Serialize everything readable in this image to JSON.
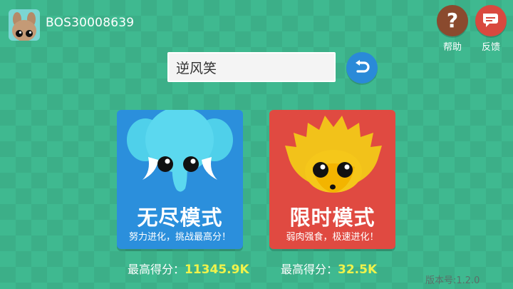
{
  "user": {
    "name": "BOS30008639"
  },
  "top_right": {
    "help_label": "帮助",
    "feedback_label": "反馈"
  },
  "name_input": {
    "value": "逆风笑"
  },
  "modes": [
    {
      "title": "无尽模式",
      "subtitle": "努力进化，挑战最高分！",
      "animal": "blue-elephant",
      "color": "#2b8fdc"
    },
    {
      "title": "限时模式",
      "subtitle": "弱肉强食，极速进化！",
      "animal": "yellow-hedgehog",
      "color": "#e04a41"
    }
  ],
  "scores": {
    "label": "最高得分：",
    "endless": "11345.9K",
    "limited": "32.5K"
  },
  "version": "版本号:1.2.0",
  "colors": {
    "background": "#3fb990",
    "score_value": "#f0f24b",
    "help_button": "#8a4a2e",
    "feedback_button": "#d9493f",
    "reset_button": "#2a8ad8"
  }
}
